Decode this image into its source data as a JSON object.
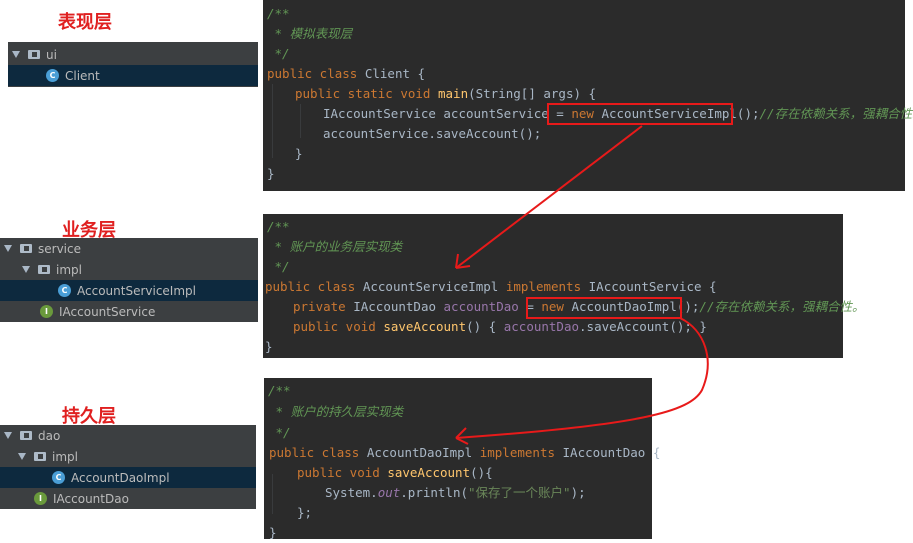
{
  "layers": {
    "presentation": "表现层",
    "business": "业务层",
    "persistence": "持久层"
  },
  "tree_ui": {
    "package": "ui",
    "client": "Client"
  },
  "tree_service": {
    "package": "service",
    "impl": "impl",
    "impl_class": "AccountServiceImpl",
    "interface": "IAccountService"
  },
  "tree_dao": {
    "package": "dao",
    "impl": "impl",
    "impl_class": "AccountDaoImpl",
    "interface": "IAccountDao"
  },
  "code_client": {
    "l1": "/**",
    "l2": " * 模拟表现层",
    "l3": " */",
    "l4_kw": "public class ",
    "l4_name": "Client {",
    "l5_kw": "public static void ",
    "l5_fn": "main",
    "l5_rest": "(String[] args) {",
    "l6_type": "IAccountService accountService = ",
    "l6_new": "new ",
    "l6_ctor": "AccountServiceImpl();",
    "l6_comment": "//存在依赖关系，强耦合性。",
    "l7": "accountService.saveAccount();",
    "l8": "}",
    "l9": "}"
  },
  "code_service": {
    "l1": "/**",
    "l2": " * 账户的业务层实现类",
    "l3": " */",
    "l4_kw": "public class ",
    "l4_name": "AccountServiceImpl ",
    "l4_impl": "implements ",
    "l4_iface": "IAccountService {",
    "l5_kw": "private ",
    "l5_type": "IAccountDao ",
    "l5_field": "accountDao",
    "l5_eq": " = ",
    "l5_new": "new ",
    "l5_ctor": "AccountDaoImpl();",
    "l5_comment": "//存在依赖关系，强耦合性。",
    "l6_kw": "public void ",
    "l6_fn": "saveAccount",
    "l6_p": "() { ",
    "l6_field": "accountDao",
    "l6_call": ".saveAccount(); }",
    "l7": "}"
  },
  "code_dao": {
    "l1": "/**",
    "l2": " * 账户的持久层实现类",
    "l3": " */",
    "l4_kw": "public class ",
    "l4_name": "AccountDaoImpl ",
    "l4_impl": "implements ",
    "l4_iface": "IAccountDao {",
    "l5_kw": "public void ",
    "l5_fn": "saveAccount",
    "l5_p": "(){",
    "l6_sys": "System.",
    "l6_out": "out",
    "l6_print": ".println(",
    "l6_str": "\"保存了一个账户\"",
    "l6_end": ");",
    "l7": "};",
    "l8": "}"
  },
  "colors": {
    "highlight": "#e81a1a",
    "editor_bg": "#2b2b2b",
    "tree_bg": "#3c3f41"
  }
}
